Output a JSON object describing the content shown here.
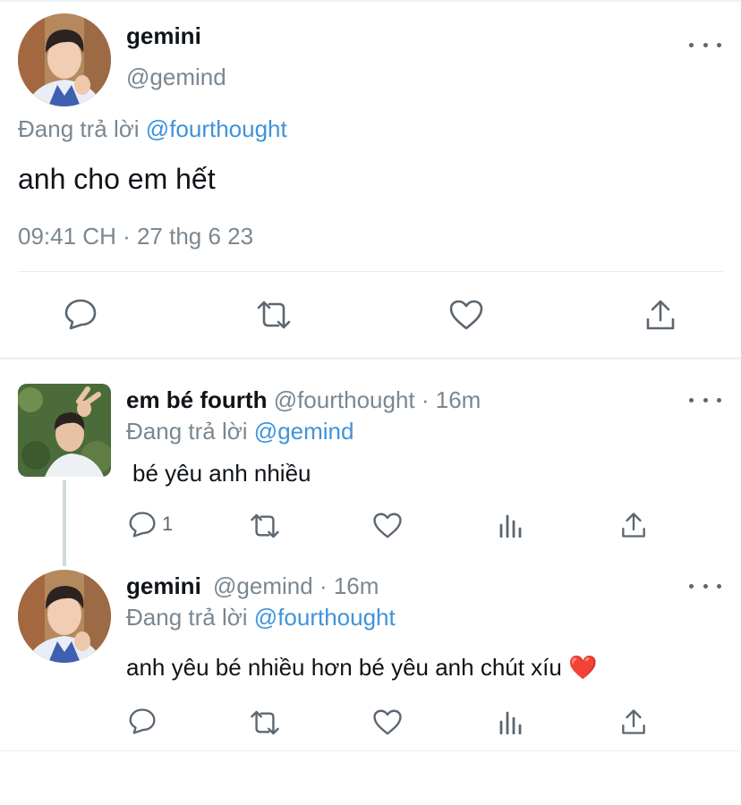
{
  "main_tweet": {
    "display_name": "gemini",
    "handle": "@gemind",
    "replying_prefix": "Đang trả lời",
    "replying_to": "@fourthought",
    "text": "anh cho em hết",
    "timestamp": "09:41 CH · 27 thg 6 23"
  },
  "replies": [
    {
      "display_name": "em bé fourth",
      "handle": "@fourthought",
      "time": "· 16m",
      "replying_prefix": "Đang trả lời",
      "replying_to": "@gemind",
      "text": "bé yêu anh nhiều",
      "reply_count": "1"
    },
    {
      "display_name": "gemini",
      "handle": "@gemind",
      "time": "· 16m",
      "replying_prefix": "Đang trả lời",
      "replying_to": "@fourthought",
      "text": "anh yêu bé nhiều hơn bé yêu anh chút xíu",
      "emoji": "❤️"
    }
  ],
  "icons": [
    "reply-icon",
    "retweet-icon",
    "like-icon",
    "share-icon",
    "views-icon",
    "more-icon"
  ],
  "colors": {
    "link": "#3f93db",
    "muted": "#7a8791",
    "icon": "#5b6670",
    "divider": "#e6ecf0"
  }
}
